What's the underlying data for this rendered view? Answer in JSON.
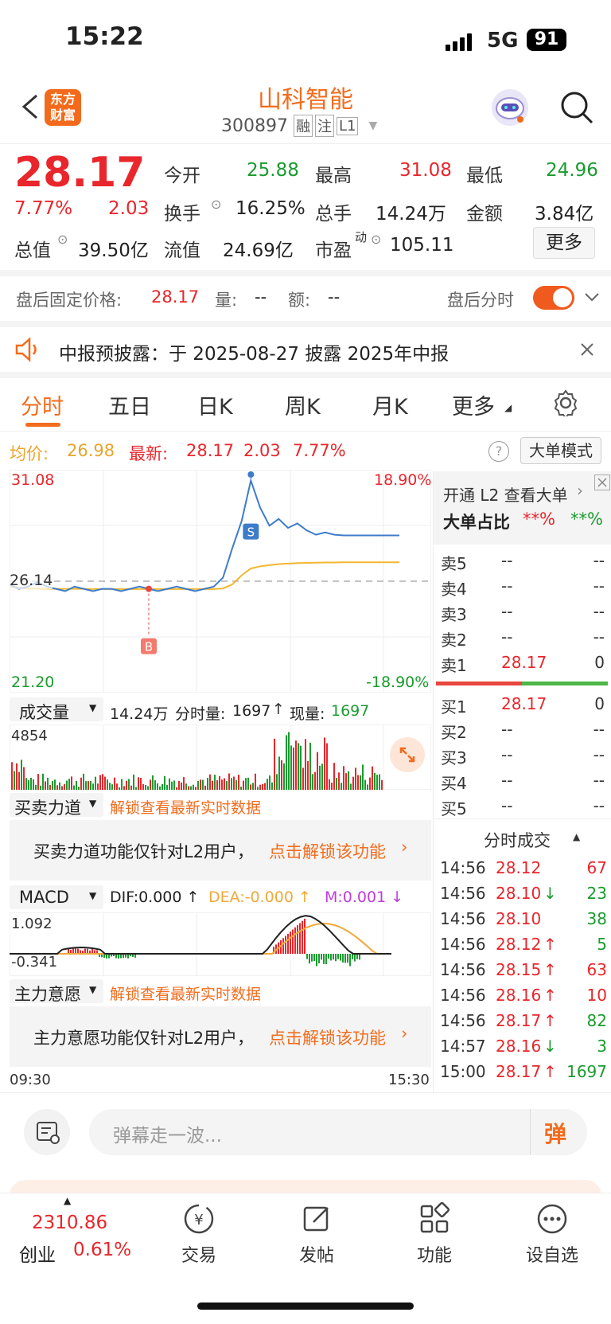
{
  "status": {
    "time": "15:22",
    "network": "5G",
    "battery": "91"
  },
  "header": {
    "logo_top": "东方",
    "logo_bottom": "财富",
    "title": "山科智能",
    "code": "300897",
    "tags": [
      "融",
      "注",
      "L1"
    ]
  },
  "quote": {
    "price": "28.17",
    "change_pct": "7.77%",
    "change": "2.03",
    "open_label": "今开",
    "open": "25.88",
    "high_label": "最高",
    "high": "31.08",
    "low_label": "最低",
    "low": "24.96",
    "turnover_label": "换手",
    "turnover": "16.25%",
    "volume_label": "总手",
    "volume": "14.24万",
    "amount_label": "金额",
    "amount": "3.84亿",
    "mktcap_label": "总值",
    "mktcap": "39.50亿",
    "float_label": "流值",
    "float": "24.69亿",
    "pe_label": "市盈",
    "pe_sup": "动",
    "pe": "105.11",
    "more_label": "更多"
  },
  "after_hours": {
    "label": "盘后固定价格:",
    "price": "28.17",
    "vol_label": "量:",
    "vol": "--",
    "amt_label": "额:",
    "amt": "--",
    "toggle_label": "盘后分时",
    "toggle_on": true
  },
  "notice": {
    "text": "中报预披露：于 2025-08-27 披露 2025年中报"
  },
  "tabs": [
    "分时",
    "五日",
    "日K",
    "周K",
    "月K",
    "更多"
  ],
  "active_tab": "分时",
  "chart_info": {
    "avg_label": "均价:",
    "avg": "26.98",
    "last_label": "最新:",
    "last": "28.17",
    "chg": "2.03",
    "chg_pct": "7.77%",
    "mode_label": "大单模式"
  },
  "chart_data": {
    "type": "line",
    "y_top": "31.08",
    "y_mid": "26.14",
    "y_bottom": "21.20",
    "pct_top": "18.90%",
    "pct_bottom": "-18.90%",
    "ylim": [
      21.2,
      31.08
    ],
    "x_start": "09:30",
    "x_end": "15:30",
    "price": [
      26.0,
      25.8,
      25.9,
      26.1,
      25.9,
      25.8,
      25.7,
      25.9,
      25.8,
      25.7,
      25.8,
      25.8,
      25.7,
      25.8,
      25.9,
      25.8,
      25.7,
      25.8,
      25.9,
      25.8,
      25.7,
      25.8,
      25.9,
      26.3,
      27.6,
      28.8,
      30.6,
      29.4,
      28.6,
      28.9,
      28.5,
      28.7,
      28.4,
      28.2,
      28.3,
      28.2,
      28.17,
      28.17,
      28.17,
      28.17,
      28.17,
      28.17,
      28.17
    ],
    "avg": [
      25.9,
      25.85,
      25.82,
      25.82,
      25.81,
      25.8,
      25.8,
      25.8,
      25.8,
      25.79,
      25.79,
      25.79,
      25.79,
      25.79,
      25.79,
      25.79,
      25.79,
      25.79,
      25.79,
      25.79,
      25.79,
      25.79,
      25.79,
      25.82,
      26.0,
      26.4,
      26.7,
      26.8,
      26.85,
      26.9,
      26.92,
      26.94,
      26.95,
      26.96,
      26.97,
      26.97,
      26.98,
      26.98,
      26.98,
      26.98,
      26.98,
      26.98,
      26.98
    ],
    "markers": [
      {
        "label": "B",
        "price": 25.8
      },
      {
        "label": "S",
        "price": 29.4
      }
    ]
  },
  "volume": {
    "label": "成交量",
    "total": "14.24万",
    "detail_label": "分时量:",
    "detail": "1697",
    "now_label": "现量:",
    "now": "1697",
    "max": "4854"
  },
  "force": {
    "label": "买卖力道",
    "unlock": "解锁查看最新实时数据",
    "msg": "买卖力道功能仅针对L2用户，",
    "link": "点击解锁该功能"
  },
  "macd": {
    "label": "MACD",
    "dif": "DIF:0.000 ↑",
    "dea": "DEA:-0.000 ↑",
    "m": "M:0.001 ↓",
    "top": "1.092",
    "bottom": "-0.341"
  },
  "main_force": {
    "label": "主力意愿",
    "unlock": "解锁查看最新实时数据",
    "msg": "主力意愿功能仅针对L2用户，",
    "link": "点击解锁该功能"
  },
  "order_book": {
    "l2_link": "开通 L2 查看大单",
    "big_ratio_label": "大单占比",
    "red_pct": "**%",
    "green_pct": "**%",
    "asks": [
      {
        "label": "卖5",
        "price": "--",
        "qty": "--"
      },
      {
        "label": "卖4",
        "price": "--",
        "qty": "--"
      },
      {
        "label": "卖3",
        "price": "--",
        "qty": "--"
      },
      {
        "label": "卖2",
        "price": "--",
        "qty": "--"
      },
      {
        "label": "卖1",
        "price": "28.17",
        "qty": "0"
      }
    ],
    "bids": [
      {
        "label": "买1",
        "price": "28.17",
        "qty": "0"
      },
      {
        "label": "买2",
        "price": "--",
        "qty": "--"
      },
      {
        "label": "买3",
        "price": "--",
        "qty": "--"
      },
      {
        "label": "买4",
        "price": "--",
        "qty": "--"
      },
      {
        "label": "买5",
        "price": "--",
        "qty": "--"
      }
    ]
  },
  "trades": {
    "title": "分时成交",
    "rows": [
      {
        "t": "14:56",
        "p": "28.12",
        "d": "",
        "q": "67",
        "pc": "red",
        "qc": "red"
      },
      {
        "t": "14:56",
        "p": "28.10",
        "d": "↓",
        "q": "23",
        "pc": "red",
        "qc": "green"
      },
      {
        "t": "14:56",
        "p": "28.10",
        "d": "",
        "q": "38",
        "pc": "red",
        "qc": "green"
      },
      {
        "t": "14:56",
        "p": "28.12",
        "d": "↑",
        "q": "5",
        "pc": "red",
        "qc": "green"
      },
      {
        "t": "14:56",
        "p": "28.15",
        "d": "↑",
        "q": "63",
        "pc": "red",
        "qc": "red"
      },
      {
        "t": "14:56",
        "p": "28.16",
        "d": "↑",
        "q": "10",
        "pc": "red",
        "qc": "red"
      },
      {
        "t": "14:56",
        "p": "28.17",
        "d": "↑",
        "q": "82",
        "pc": "red",
        "qc": "green"
      },
      {
        "t": "14:57",
        "p": "28.16",
        "d": "↓",
        "q": "3",
        "pc": "red",
        "qc": "green"
      },
      {
        "t": "15:00",
        "p": "28.17",
        "d": "↑",
        "q": "1697",
        "pc": "red",
        "qc": "green"
      }
    ]
  },
  "comment": {
    "placeholder": "弹幕走一波...",
    "btn": "弹"
  },
  "bottom_nav": {
    "index_value": "2310.86",
    "index_name": "创业",
    "index_pct": "0.61%",
    "items": [
      "交易",
      "发帖",
      "功能",
      "设自选"
    ]
  }
}
